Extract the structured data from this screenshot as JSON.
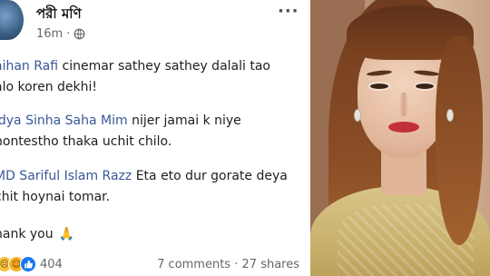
{
  "post": {
    "author": "পরী মণি",
    "time": "16m",
    "more": "···"
  },
  "comments": [
    {
      "name": "aihan Rafi",
      "text": " cinemar sathey sathey dalali tao",
      "text2": "alo koren dekhi!"
    },
    {
      "name": "idya Sinha Saha Mim",
      "text": " nijer jamai k niye",
      "text2": "hontestho thaka uchit chilo."
    },
    {
      "name": "MD Sariful Islam Razz",
      "text": " Eta eto dur gorate deya",
      "text2": "chit hoynai tomar."
    },
    {
      "text": "hank you",
      "emoji": "🙏"
    }
  ],
  "footer": {
    "reaction_count": "404",
    "comments": "7 comments",
    "separator": "·",
    "shares": "27 shares"
  },
  "colors": {
    "mention": "#385898",
    "meta": "#65676b",
    "like": "#1877f2"
  },
  "icons": [
    "more-icon",
    "globe-icon",
    "sad-reaction-icon",
    "haha-reaction-icon",
    "like-reaction-icon",
    "folded-hands-emoji"
  ]
}
